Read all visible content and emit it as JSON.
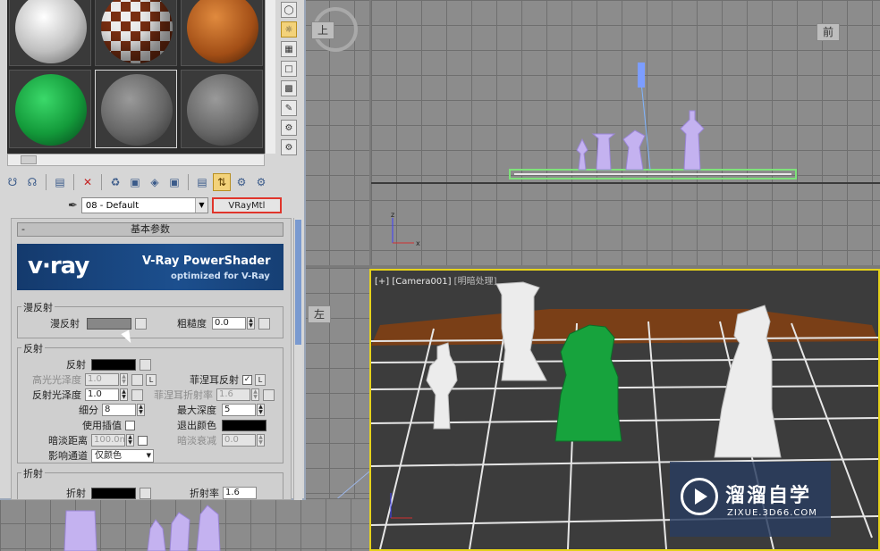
{
  "material_editor": {
    "samples": [
      {
        "name": "sample-sphere-white",
        "color": "#e0e0e0"
      },
      {
        "name": "sample-sphere-checker",
        "color": "#b86a2e"
      },
      {
        "name": "sample-sphere-wood",
        "color": "#b2561c"
      },
      {
        "name": "sample-sphere-green",
        "color": "#159a3c"
      },
      {
        "name": "sample-sphere-gray-1",
        "color": "#7a7a7a"
      },
      {
        "name": "sample-sphere-gray-2",
        "color": "#7a7a7a"
      }
    ],
    "material_name": "08 - Default",
    "material_type": "VRayMtl",
    "rollout_title": "基本参数",
    "banner": {
      "logo": "v·ray",
      "title": "V-Ray PowerShader",
      "subtitle": "optimized for V-Ray"
    },
    "diffuse_group": {
      "title": "漫反射",
      "diffuse_label": "漫反射",
      "roughness_label": "粗糙度",
      "roughness_value": "0.0",
      "diffuse_color": "#878787"
    },
    "reflection_group": {
      "title": "反射",
      "reflect_label": "反射",
      "reflect_color": "#000000",
      "hilight_gloss_label": "高光光泽度",
      "hilight_gloss_value": "1.0",
      "fresnel_label": "菲涅耳反射",
      "refl_gloss_label": "反射光泽度",
      "refl_gloss_value": "1.0",
      "fresnel_ior_label": "菲涅耳折射率",
      "fresnel_ior_value": "1.6",
      "subdivs_label": "细分",
      "subdivs_value": "8",
      "max_depth_label": "最大深度",
      "max_depth_value": "5",
      "use_interp_label": "使用插值",
      "exit_color_label": "退出颜色",
      "exit_color": "#000000",
      "dim_distance_label": "暗淡距离",
      "dim_distance_value": "100.0n",
      "dim_falloff_label": "暗淡衰减",
      "dim_falloff_value": "0.0",
      "affect_channels_label": "影响通道",
      "affect_channels_value": "仅颜色",
      "l_button": "L"
    },
    "refraction_group": {
      "title": "折射",
      "refract_label": "折射",
      "ior_label": "折射率",
      "ior_value": "1.6"
    }
  },
  "viewports": {
    "front_cube_label": "前",
    "top_cube_label": "上",
    "left_cube_label": "左",
    "camera_label_prefix": "[+] [Camera001] ",
    "camera_label_mode": "[明暗处理]"
  },
  "watermark": {
    "title": "溜溜自学",
    "url": "ZIXUE.3D66.COM"
  },
  "colors": {
    "active_border": "#e5d21a",
    "chess_white": "#e9e9e9",
    "chess_green": "#17a33d",
    "board_line": "#e6e6e6",
    "frame_wood": "#8a4a1e"
  }
}
